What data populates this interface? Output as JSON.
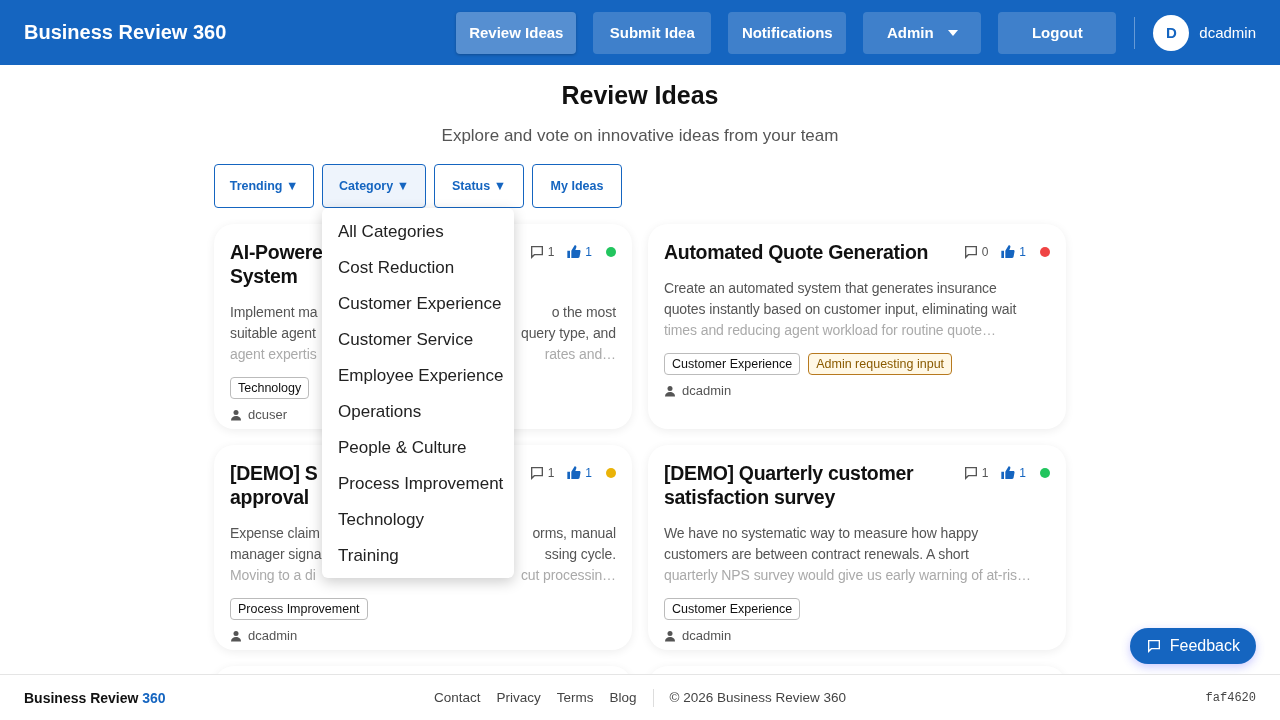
{
  "header": {
    "brand": "Business Review 360",
    "nav": [
      {
        "label": "Review Ideas",
        "selected": true,
        "kind": "link"
      },
      {
        "label": "Submit Idea",
        "selected": false,
        "kind": "link"
      },
      {
        "label": "Notifications",
        "selected": false,
        "kind": "link"
      },
      {
        "label": "Admin",
        "selected": false,
        "kind": "menu"
      },
      {
        "label": "Logout",
        "selected": false,
        "kind": "link"
      }
    ],
    "avatar": "D",
    "user": "dcadmin"
  },
  "page": {
    "title": "Review Ideas",
    "subtitle": "Explore and vote on innovative ideas from your team"
  },
  "filters": [
    {
      "label": "Trending ▼",
      "expanded": false
    },
    {
      "label": "Category ▼",
      "expanded": true
    },
    {
      "label": "Status ▼",
      "expanded": false
    },
    {
      "label": "My Ideas",
      "expanded": false
    }
  ],
  "category_menu": [
    "All Categories",
    "Cost Reduction",
    "Customer Experience",
    "Customer Service",
    "Employee Experience",
    "Operations",
    "People & Culture",
    "Process Improvement",
    "Technology",
    "Training"
  ],
  "ideas": [
    {
      "title_lines": [
        "AI-Powere",
        "System"
      ],
      "comments": "1",
      "votes": "1",
      "color": "#22c55e",
      "description_lines": [
        {
          "left": "Implement ma",
          "right": "o the most"
        },
        {
          "left": "suitable agent",
          "right": "query type, and"
        },
        {
          "left": "agent expertis",
          "right": "rates and…"
        }
      ],
      "tags": [
        {
          "label": "Technology",
          "kind": "category"
        }
      ],
      "author": "dcuser"
    },
    {
      "title_lines": [
        "Automated Quote Generation"
      ],
      "comments": "0",
      "votes": "1",
      "color": "#ef4444",
      "description_lines": [
        {
          "left": "Create an automated system that generates insurance"
        },
        {
          "left": "quotes instantly based on customer input, eliminating wait"
        },
        {
          "left": "times and reducing agent workload for routine quote…"
        }
      ],
      "tags": [
        {
          "label": "Customer Experience",
          "kind": "category"
        },
        {
          "label": "Admin requesting input",
          "kind": "status"
        }
      ],
      "author": "dcadmin"
    },
    {
      "title_lines": [
        "[DEMO] S",
        "approval"
      ],
      "comments": "1",
      "votes": "1",
      "color": "#eab308",
      "description_lines": [
        {
          "left": "Expense claim",
          "right": "orms, manual"
        },
        {
          "left": "manager signa",
          "right": "ssing cycle."
        },
        {
          "left": "Moving to a di",
          "right": "cut processin…"
        }
      ],
      "tags": [
        {
          "label": "Process Improvement",
          "kind": "category"
        }
      ],
      "author": "dcadmin"
    },
    {
      "title_lines": [
        "[DEMO] Quarterly customer",
        "satisfaction survey"
      ],
      "comments": "1",
      "votes": "1",
      "color": "#22c55e",
      "description_lines": [
        {
          "left": "We have no systematic way to measure how happy"
        },
        {
          "left": "customers are between contract renewals. A short"
        },
        {
          "left": "quarterly NPS survey would give us early warning of at-ris…"
        }
      ],
      "tags": [
        {
          "label": "Customer Experience",
          "kind": "category"
        }
      ],
      "author": "dcadmin"
    }
  ],
  "feedback_button": "Feedback",
  "footer": {
    "brand": "Business Review",
    "brand_accent": "360",
    "links": [
      "Contact",
      "Privacy",
      "Terms",
      "Blog"
    ],
    "copyright": "© 2026 Business Review 360",
    "build": "faf4620"
  }
}
